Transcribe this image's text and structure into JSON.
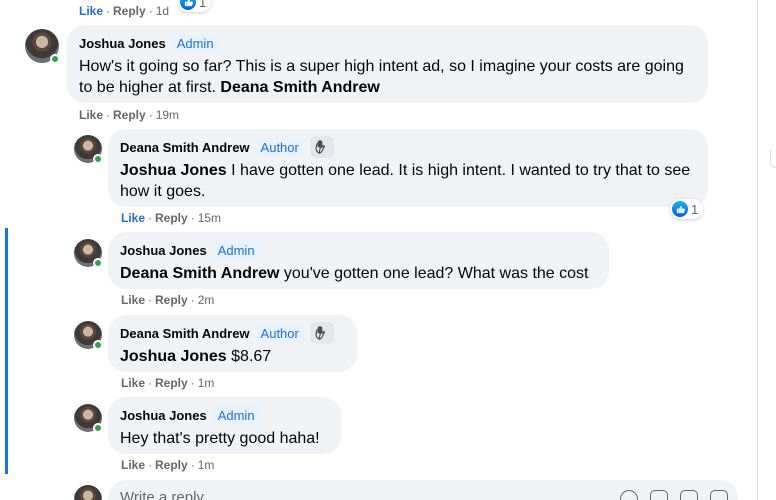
{
  "top_actions": {
    "like": "Like",
    "reply": "Reply",
    "time": "1d",
    "reaction_count": "1"
  },
  "comments": [
    {
      "author": "Joshua Jones",
      "badge": "Admin",
      "text": "How's it going so far? This is a super high intent ad, so I imagine your costs are going to be higher at first.",
      "mention": "Deana Smith Andrew",
      "like": "Like",
      "reply": "Reply",
      "time": "19m"
    },
    {
      "author": "Deana Smith Andrew",
      "badge": "Author",
      "mention": "Joshua Jones",
      "text": "I have gotten one lead. It is high intent. I wanted to try that to see how it goes.",
      "like": "Like",
      "reply": "Reply",
      "time": "15m",
      "reaction_count": "1"
    },
    {
      "author": "Joshua Jones",
      "badge": "Admin",
      "mention": "Deana Smith Andrew",
      "text": "you've gotten one lead? What was the cost",
      "like": "Like",
      "reply": "Reply",
      "time": "2m"
    },
    {
      "author": "Deana Smith Andrew",
      "badge": "Author",
      "mention": "Joshua Jones",
      "text": "$8.67",
      "like": "Like",
      "reply": "Reply",
      "time": "1m"
    },
    {
      "author": "Joshua Jones",
      "badge": "Admin",
      "text": "Hey that's pretty good haha!",
      "like": "Like",
      "reply": "Reply",
      "time": "1m"
    }
  ],
  "reply_box": {
    "placeholder": "Write a reply..."
  },
  "colors": {
    "accent": "#216fdb",
    "bubble": "#f0f2f5",
    "online": "#31a24c",
    "rail": "#1b74e4"
  },
  "icons": [
    "like-reaction-icon",
    "wave-icon",
    "emoji-icon",
    "camera-icon",
    "gif-icon",
    "sticker-icon"
  ]
}
